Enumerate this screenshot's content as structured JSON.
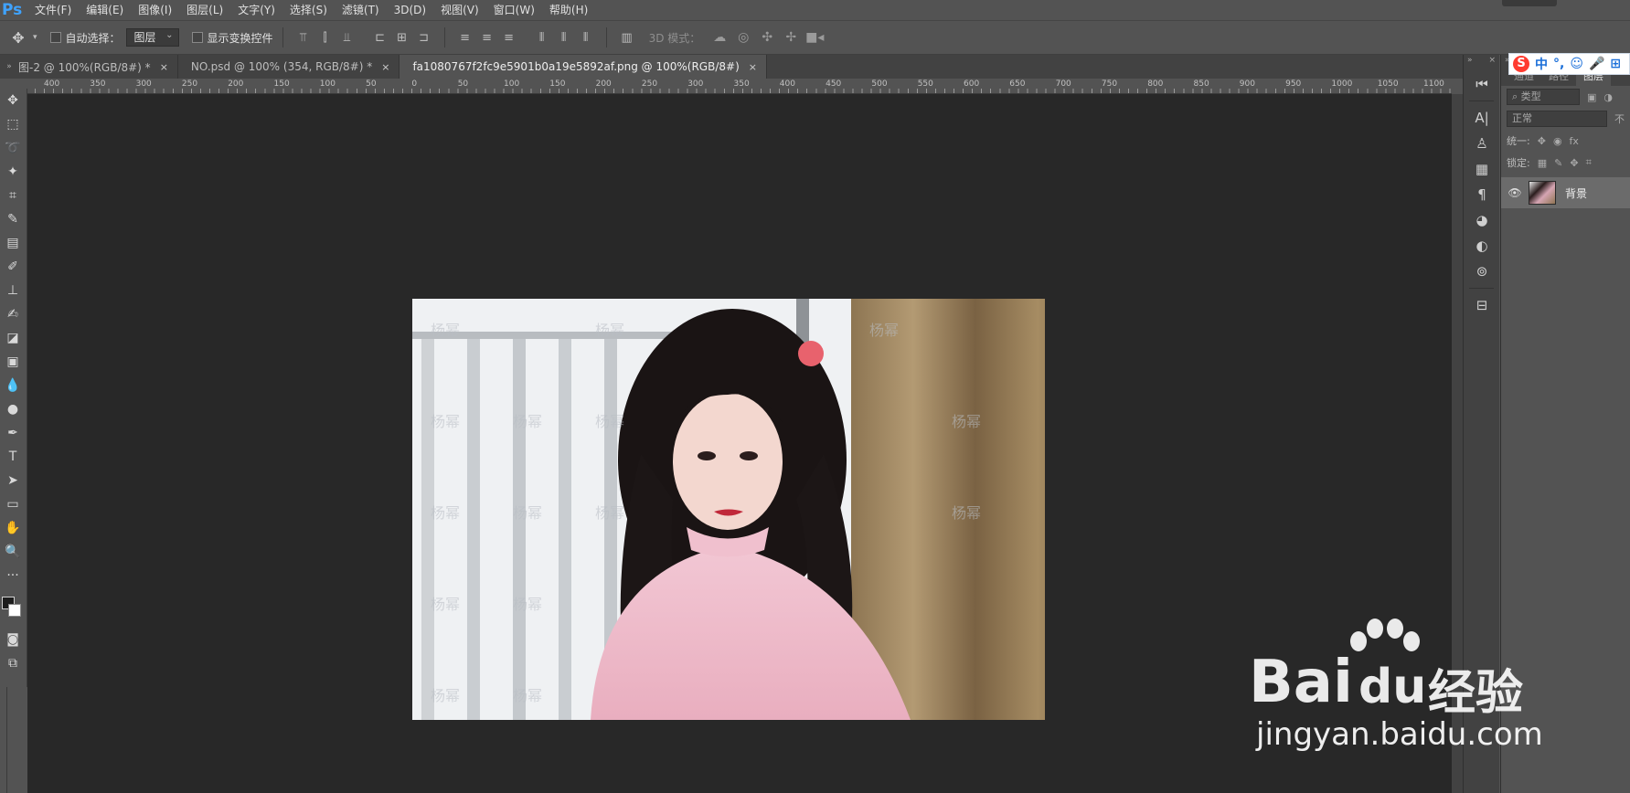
{
  "app": {
    "logo": "Ps",
    "menu": [
      "文件(F)",
      "编辑(E)",
      "图像(I)",
      "图层(L)",
      "文字(Y)",
      "选择(S)",
      "滤镜(T)",
      "3D(D)",
      "视图(V)",
      "窗口(W)",
      "帮助(H)"
    ]
  },
  "options": {
    "auto_select_label": "自动选择：",
    "auto_select_target": "图层",
    "show_transform_label": "显示变换控件",
    "mode3d_label": "3D 模式："
  },
  "tabs": [
    {
      "label": "图-2 @ 100%(RGB/8#) *",
      "close": "×"
    },
    {
      "label": "NO.psd @ 100% (354, RGB/8#) *",
      "close": "×"
    },
    {
      "label": "fa1080767f2fc9e5901b0a19e5892af.png @ 100%(RGB/8#)",
      "close": "×"
    }
  ],
  "ruler": {
    "labels": [
      "400",
      "350",
      "300",
      "250",
      "200",
      "150",
      "100",
      "50",
      "0",
      "50",
      "100",
      "150",
      "200",
      "250",
      "300",
      "350",
      "400",
      "450",
      "500",
      "550",
      "600",
      "650",
      "700",
      "750",
      "800",
      "850",
      "900",
      "950",
      "1000",
      "1050",
      "1100"
    ]
  },
  "tools": [
    "move-tool",
    "marquee-tool",
    "lasso-tool",
    "magic-wand-tool",
    "crop-tool",
    "eyedropper-tool",
    "healing-tool",
    "brush-tool",
    "stamp-tool",
    "history-brush-tool",
    "eraser-tool",
    "gradient-tool",
    "blur-tool",
    "dodge-tool",
    "pen-tool",
    "type-tool",
    "path-select-tool",
    "rectangle-tool",
    "hand-tool",
    "zoom-tool",
    "more-tools"
  ],
  "photo_watermark": "杨幂",
  "layers_panel": {
    "tabs": [
      "通道",
      "路径",
      "图层"
    ],
    "filter_placeholder": "类型",
    "blend_mode": "正常",
    "opacity_label": "不",
    "unify_label": "统一:",
    "lock_label": "锁定:",
    "layer_name": "背景"
  },
  "ime": {
    "logo": "S",
    "items": [
      "中",
      "°,",
      "☺",
      "🎤",
      "⊞"
    ]
  },
  "watermark": {
    "brand": "Bai",
    "brand2": "du",
    "cn": "经验",
    "url": "jingyan.baidu.com"
  },
  "colors": {
    "panel": "#535353",
    "canvas": "#282828",
    "accent": "#3fa3ff"
  }
}
